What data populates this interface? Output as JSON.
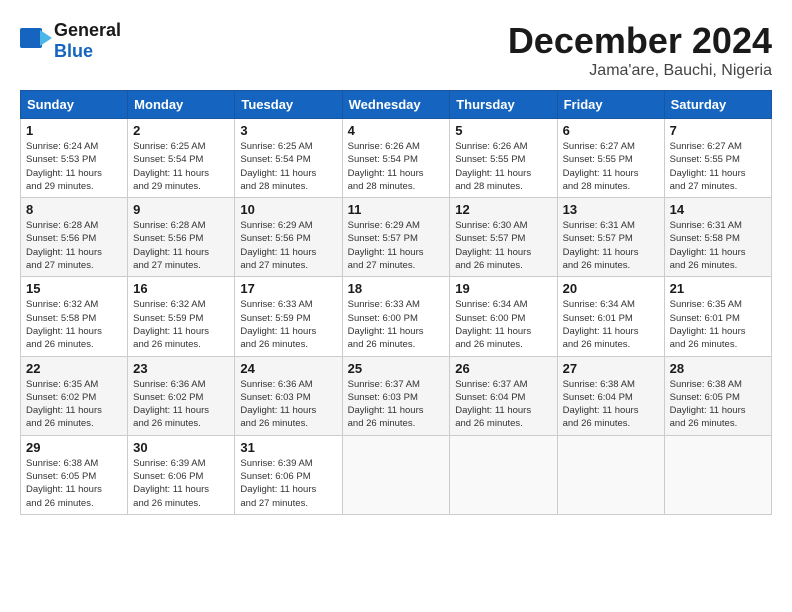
{
  "logo": {
    "general": "General",
    "blue": "Blue"
  },
  "title": {
    "month": "December 2024",
    "location": "Jama'are, Bauchi, Nigeria"
  },
  "days_of_week": [
    "Sunday",
    "Monday",
    "Tuesday",
    "Wednesday",
    "Thursday",
    "Friday",
    "Saturday"
  ],
  "weeks": [
    [
      {
        "day": "1",
        "info": "Sunrise: 6:24 AM\nSunset: 5:53 PM\nDaylight: 11 hours\nand 29 minutes."
      },
      {
        "day": "2",
        "info": "Sunrise: 6:25 AM\nSunset: 5:54 PM\nDaylight: 11 hours\nand 29 minutes."
      },
      {
        "day": "3",
        "info": "Sunrise: 6:25 AM\nSunset: 5:54 PM\nDaylight: 11 hours\nand 28 minutes."
      },
      {
        "day": "4",
        "info": "Sunrise: 6:26 AM\nSunset: 5:54 PM\nDaylight: 11 hours\nand 28 minutes."
      },
      {
        "day": "5",
        "info": "Sunrise: 6:26 AM\nSunset: 5:55 PM\nDaylight: 11 hours\nand 28 minutes."
      },
      {
        "day": "6",
        "info": "Sunrise: 6:27 AM\nSunset: 5:55 PM\nDaylight: 11 hours\nand 28 minutes."
      },
      {
        "day": "7",
        "info": "Sunrise: 6:27 AM\nSunset: 5:55 PM\nDaylight: 11 hours\nand 27 minutes."
      }
    ],
    [
      {
        "day": "8",
        "info": "Sunrise: 6:28 AM\nSunset: 5:56 PM\nDaylight: 11 hours\nand 27 minutes."
      },
      {
        "day": "9",
        "info": "Sunrise: 6:28 AM\nSunset: 5:56 PM\nDaylight: 11 hours\nand 27 minutes."
      },
      {
        "day": "10",
        "info": "Sunrise: 6:29 AM\nSunset: 5:56 PM\nDaylight: 11 hours\nand 27 minutes."
      },
      {
        "day": "11",
        "info": "Sunrise: 6:29 AM\nSunset: 5:57 PM\nDaylight: 11 hours\nand 27 minutes."
      },
      {
        "day": "12",
        "info": "Sunrise: 6:30 AM\nSunset: 5:57 PM\nDaylight: 11 hours\nand 26 minutes."
      },
      {
        "day": "13",
        "info": "Sunrise: 6:31 AM\nSunset: 5:57 PM\nDaylight: 11 hours\nand 26 minutes."
      },
      {
        "day": "14",
        "info": "Sunrise: 6:31 AM\nSunset: 5:58 PM\nDaylight: 11 hours\nand 26 minutes."
      }
    ],
    [
      {
        "day": "15",
        "info": "Sunrise: 6:32 AM\nSunset: 5:58 PM\nDaylight: 11 hours\nand 26 minutes."
      },
      {
        "day": "16",
        "info": "Sunrise: 6:32 AM\nSunset: 5:59 PM\nDaylight: 11 hours\nand 26 minutes."
      },
      {
        "day": "17",
        "info": "Sunrise: 6:33 AM\nSunset: 5:59 PM\nDaylight: 11 hours\nand 26 minutes."
      },
      {
        "day": "18",
        "info": "Sunrise: 6:33 AM\nSunset: 6:00 PM\nDaylight: 11 hours\nand 26 minutes."
      },
      {
        "day": "19",
        "info": "Sunrise: 6:34 AM\nSunset: 6:00 PM\nDaylight: 11 hours\nand 26 minutes."
      },
      {
        "day": "20",
        "info": "Sunrise: 6:34 AM\nSunset: 6:01 PM\nDaylight: 11 hours\nand 26 minutes."
      },
      {
        "day": "21",
        "info": "Sunrise: 6:35 AM\nSunset: 6:01 PM\nDaylight: 11 hours\nand 26 minutes."
      }
    ],
    [
      {
        "day": "22",
        "info": "Sunrise: 6:35 AM\nSunset: 6:02 PM\nDaylight: 11 hours\nand 26 minutes."
      },
      {
        "day": "23",
        "info": "Sunrise: 6:36 AM\nSunset: 6:02 PM\nDaylight: 11 hours\nand 26 minutes."
      },
      {
        "day": "24",
        "info": "Sunrise: 6:36 AM\nSunset: 6:03 PM\nDaylight: 11 hours\nand 26 minutes."
      },
      {
        "day": "25",
        "info": "Sunrise: 6:37 AM\nSunset: 6:03 PM\nDaylight: 11 hours\nand 26 minutes."
      },
      {
        "day": "26",
        "info": "Sunrise: 6:37 AM\nSunset: 6:04 PM\nDaylight: 11 hours\nand 26 minutes."
      },
      {
        "day": "27",
        "info": "Sunrise: 6:38 AM\nSunset: 6:04 PM\nDaylight: 11 hours\nand 26 minutes."
      },
      {
        "day": "28",
        "info": "Sunrise: 6:38 AM\nSunset: 6:05 PM\nDaylight: 11 hours\nand 26 minutes."
      }
    ],
    [
      {
        "day": "29",
        "info": "Sunrise: 6:38 AM\nSunset: 6:05 PM\nDaylight: 11 hours\nand 26 minutes."
      },
      {
        "day": "30",
        "info": "Sunrise: 6:39 AM\nSunset: 6:06 PM\nDaylight: 11 hours\nand 26 minutes."
      },
      {
        "day": "31",
        "info": "Sunrise: 6:39 AM\nSunset: 6:06 PM\nDaylight: 11 hours\nand 27 minutes."
      },
      {
        "day": "",
        "info": ""
      },
      {
        "day": "",
        "info": ""
      },
      {
        "day": "",
        "info": ""
      },
      {
        "day": "",
        "info": ""
      }
    ]
  ]
}
